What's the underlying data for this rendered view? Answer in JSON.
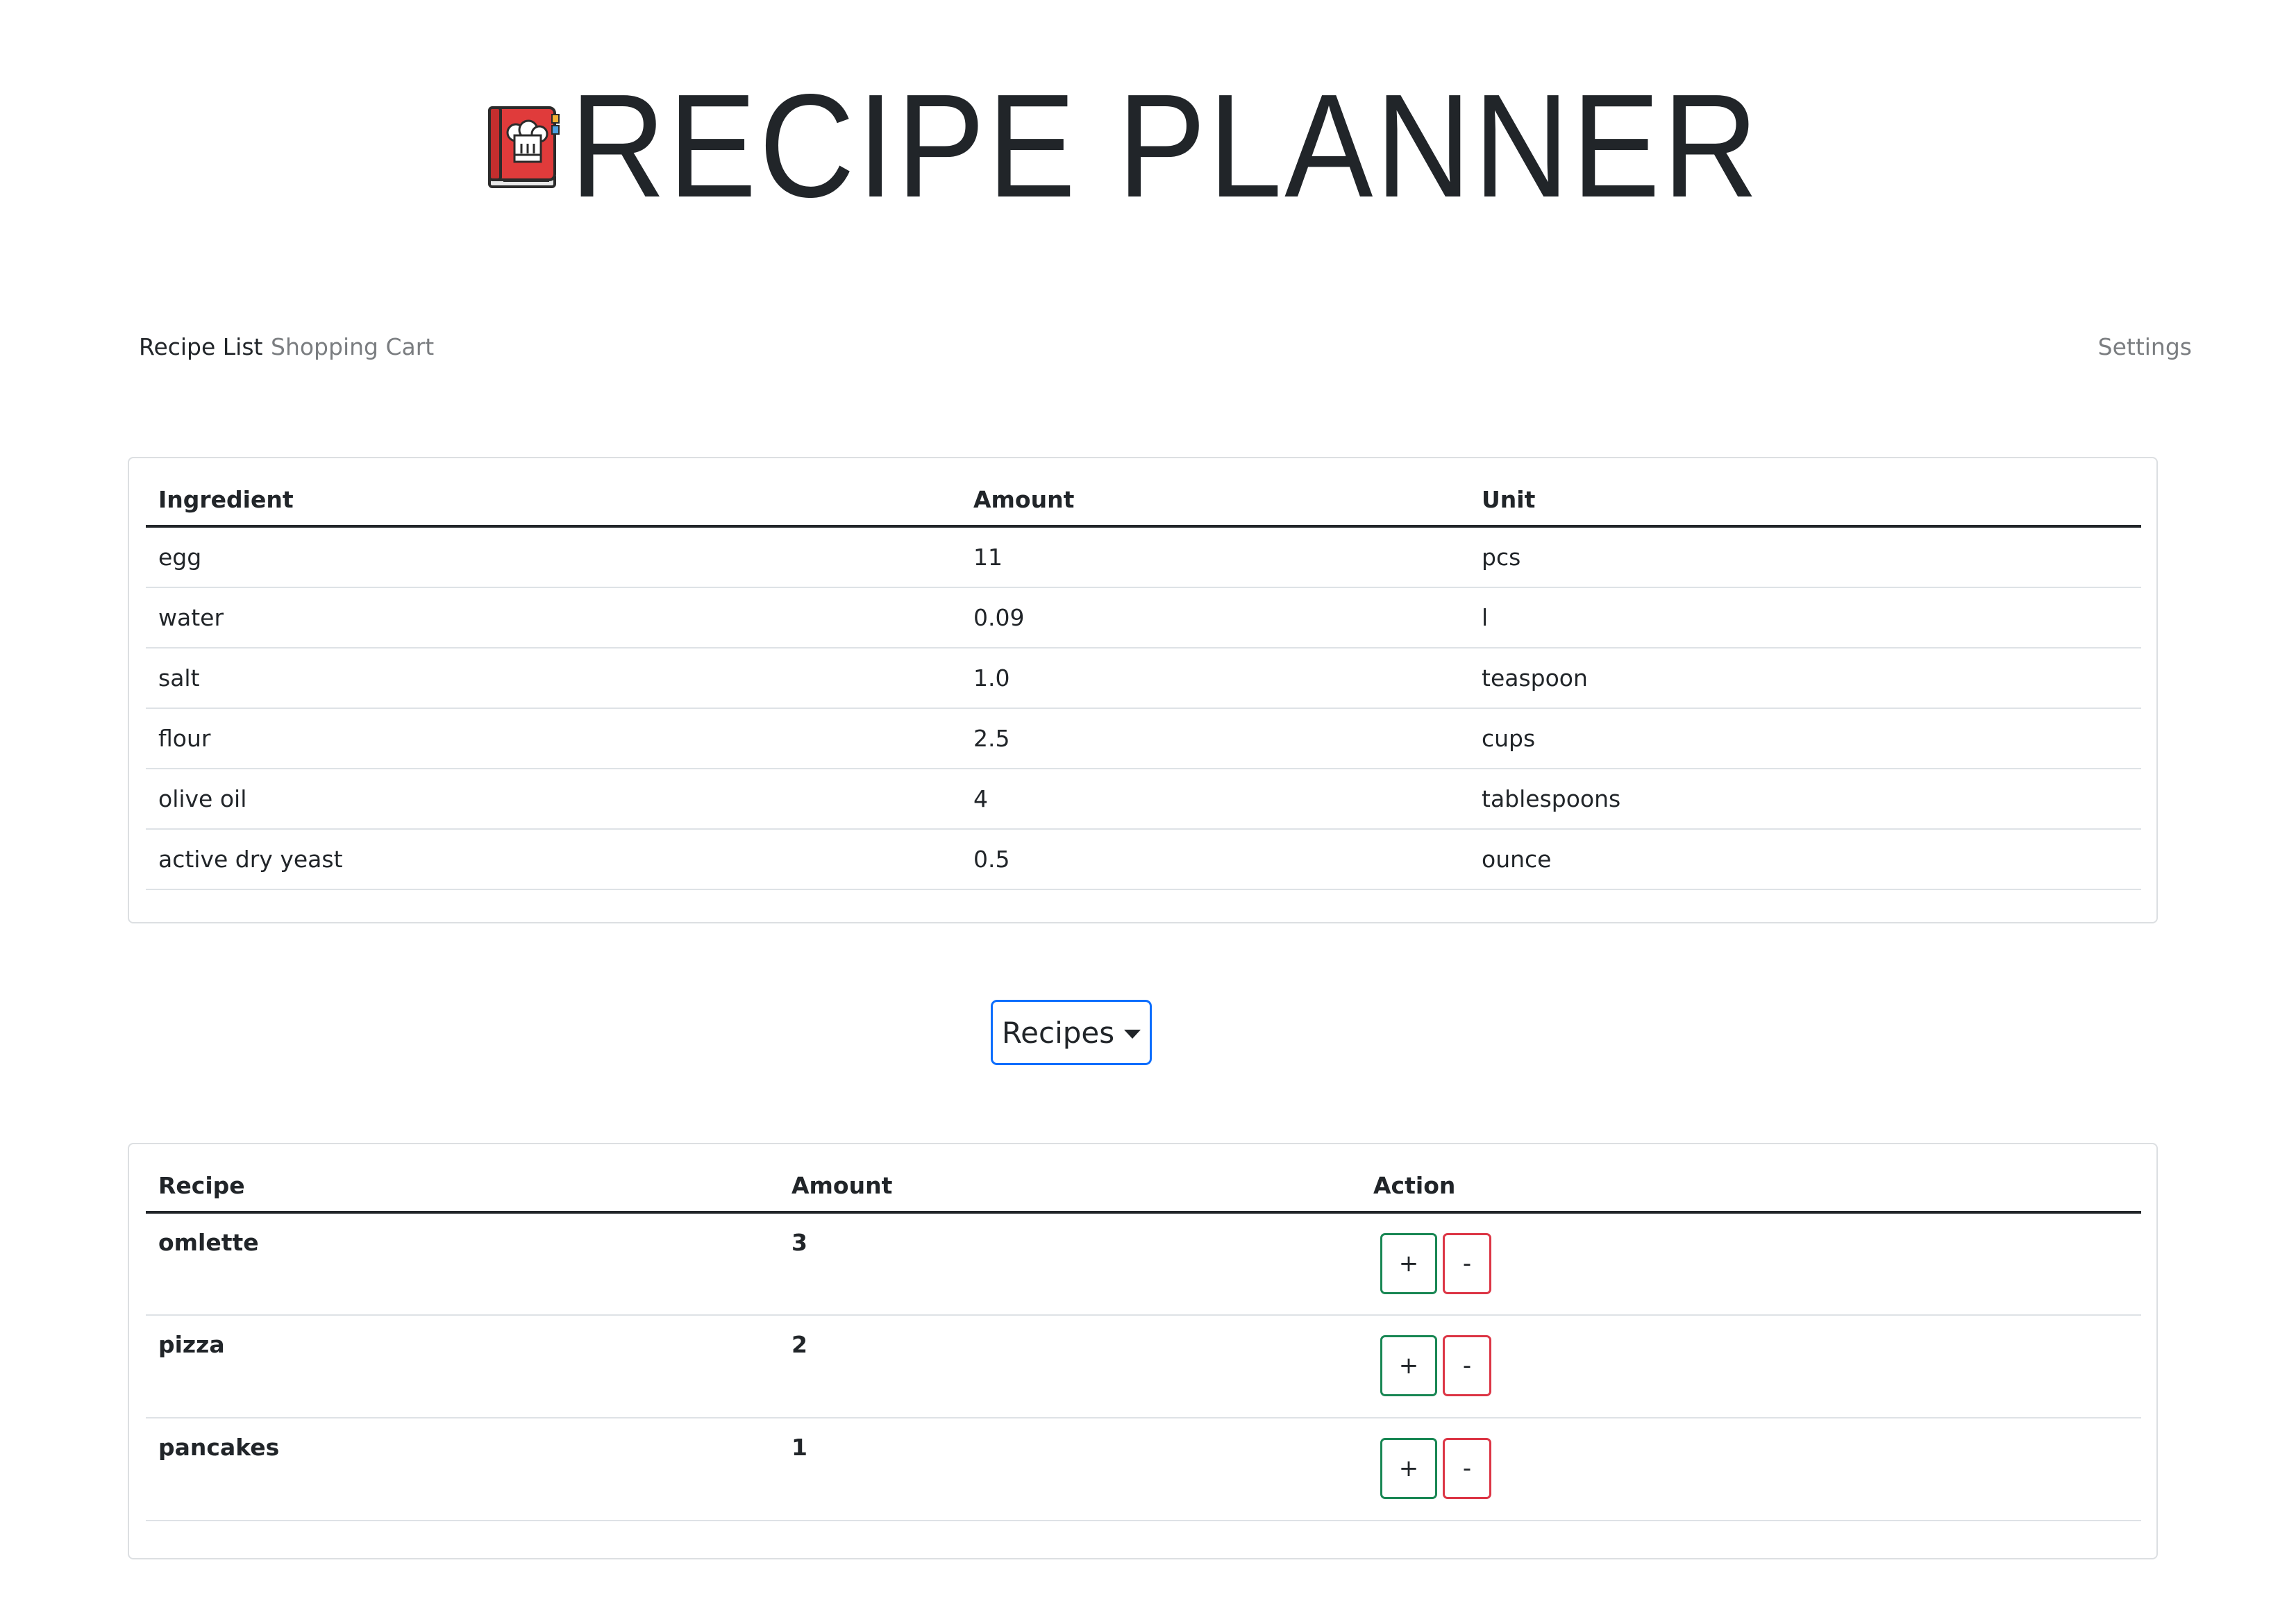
{
  "app": {
    "title": "RECIPE PLANNER",
    "logo_icon": "recipe-book-chef-hat-icon"
  },
  "nav": {
    "recipe_list": "Recipe List",
    "shopping_cart": "Shopping Cart",
    "settings": "Settings"
  },
  "ingredients_table": {
    "headers": [
      "Ingredient",
      "Amount",
      "Unit"
    ],
    "rows": [
      [
        "egg",
        "11",
        "pcs"
      ],
      [
        "water",
        "0.09",
        "l"
      ],
      [
        "salt",
        "1.0",
        "teaspoon"
      ],
      [
        "flour",
        "2.5",
        "cups"
      ],
      [
        "olive oil",
        "4",
        "tablespoons"
      ],
      [
        "active dry yeast",
        "0.5",
        "ounce"
      ]
    ]
  },
  "recipes_dropdown": {
    "label": "Recipes"
  },
  "recipes_table": {
    "headers": [
      "Recipe",
      "Amount",
      "Action"
    ],
    "plus_label": "+",
    "minus_label": "-",
    "rows": [
      [
        "omlette",
        "3"
      ],
      [
        "pizza",
        "2"
      ],
      [
        "pancakes",
        "1"
      ]
    ]
  },
  "colors": {
    "text": "#212529",
    "muted_nav": "#7a7d80",
    "primary": "#0d6efd",
    "success": "#198754",
    "danger": "#dc3545",
    "logo_red": "#e03b3b"
  }
}
